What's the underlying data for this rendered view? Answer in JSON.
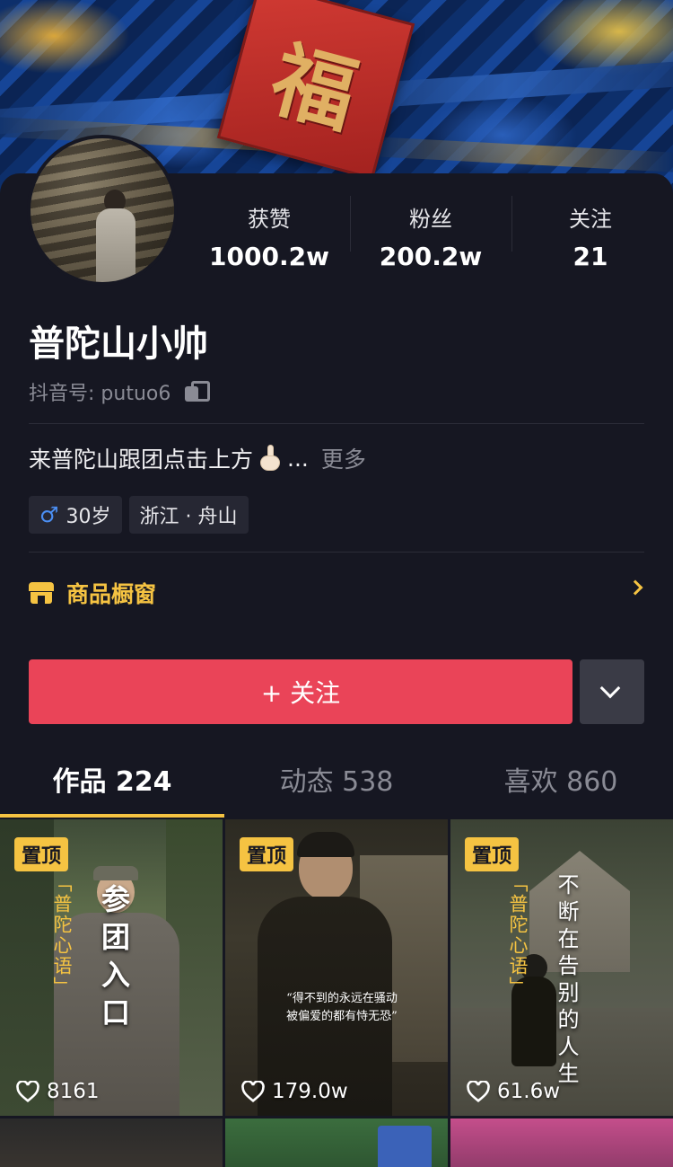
{
  "banner": {
    "sign_text": "福"
  },
  "profile": {
    "stats": [
      {
        "label": "获赞",
        "value": "1000.2w"
      },
      {
        "label": "粉丝",
        "value": "200.2w"
      },
      {
        "label": "关注",
        "value": "21"
      }
    ],
    "name": "普陀山小帅",
    "uid": "抖音号: putuo6",
    "bio": "来普陀山跟团点击上方",
    "bio_ellipsis": "...",
    "bio_more": "更多",
    "tags": {
      "gender_age": "30岁",
      "location": "浙江 · 舟山"
    },
    "shop_label": "商品橱窗",
    "follow_label": "+ 关注"
  },
  "tabs": [
    {
      "label": "作品 224",
      "active": true
    },
    {
      "label": "动态 538",
      "active": false
    },
    {
      "label": "喜欢 860",
      "active": false
    }
  ],
  "videos": [
    {
      "pinned": "置顶",
      "likes": "8161",
      "side_title": "「普陀心语」",
      "overlay": "参团入口"
    },
    {
      "pinned": "置顶",
      "likes": "179.0w",
      "caption": "“得不到的永远在骚动\n被偏爱的都有恃无恐”"
    },
    {
      "pinned": "置顶",
      "likes": "61.6w",
      "side_title": "「普陀心语」",
      "poem": "不断在告别的人生"
    }
  ],
  "colors": {
    "accent_red": "#ea4458",
    "accent_yellow": "#f5c342",
    "background": "#161722"
  }
}
